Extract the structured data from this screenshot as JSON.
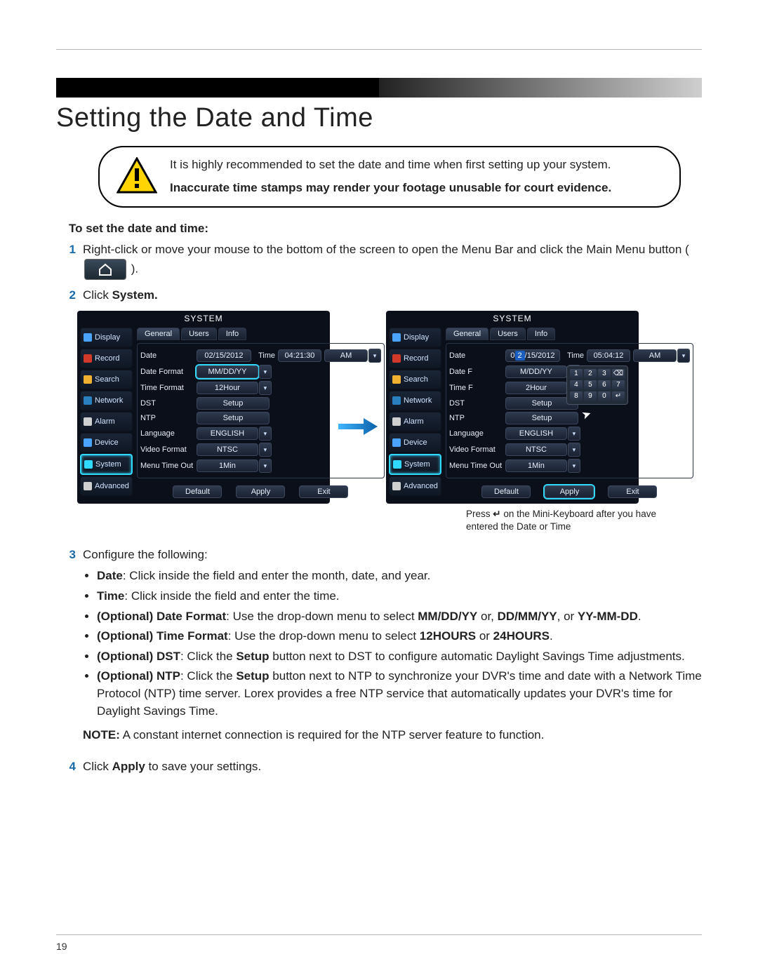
{
  "page_number": "19",
  "title": "Setting the Date and Time",
  "callout": {
    "line1": "It is highly recommended to set the date and time when first setting up your system.",
    "line2_bold": "Inaccurate time stamps may render your footage unusable for court evidence."
  },
  "subhead": "To set the date and time:",
  "steps": {
    "s1_a": "Right-click or move your mouse to the bottom of the screen to open the Menu Bar and click the Main Menu button (",
    "s1_b": ").",
    "s2_a": "Click ",
    "s2_b": "System.",
    "s3_intro": "Configure the following:",
    "s3_bullets": {
      "b1_bold": "Date",
      "b1_rest": ": Click inside the field and enter the month, date, and year.",
      "b2_bold": "Time",
      "b2_rest": ": Click inside the field and enter the time.",
      "b3_bold": "(Optional) Date Format",
      "b3_rest_a": ": Use the drop-down menu to select ",
      "b3_opt1": "MM/DD/YY",
      "b3_mid1": " or, ",
      "b3_opt2": "DD/MM/YY",
      "b3_mid2": ", or ",
      "b3_opt3": "YY-MM-DD",
      "b3_end": ".",
      "b4_bold": "(Optional) Time Format",
      "b4_rest_a": ": Use the drop-down menu to select ",
      "b4_opt1": "12HOURS",
      "b4_mid": " or ",
      "b4_opt2": "24HOURS",
      "b4_end": ".",
      "b5_bold": "(Optional) DST",
      "b5_rest_a": ": Click the ",
      "b5_setup": "Setup",
      "b5_rest_b": " button next to DST to configure automatic Daylight Savings Time adjustments.",
      "b6_bold": "(Optional) NTP",
      "b6_rest_a": ": Click the ",
      "b6_setup": "Setup",
      "b6_rest_b": " button next to NTP to synchronize your DVR's time and date with a Network Time Protocol (NTP) time server. Lorex provides a free NTP service that automatically updates your DVR's time for Daylight Savings Time."
    },
    "note_bold": "NOTE:",
    "note_rest": " A constant internet connection is required for the NTP server feature to function.",
    "s4_a": "Click ",
    "s4_b": "Apply",
    "s4_c": " to save your settings."
  },
  "caption": {
    "line1_a": "Press ",
    "line1_b": " on the Mini-Keyboard after you have entered the Date or Time"
  },
  "dvr": {
    "title": "SYSTEM",
    "side_items": [
      "Display",
      "Record",
      "Search",
      "Network",
      "Alarm",
      "Device",
      "System",
      "Advanced"
    ],
    "tabs": [
      "General",
      "Users",
      "Info"
    ],
    "left": {
      "date_label": "Date",
      "date_value": "02/15/2012",
      "time_label": "Time",
      "time_value": "04:21:30",
      "ampm": "AM",
      "rows": [
        {
          "label": "Date Format",
          "value": "MM/DD/YY",
          "type": "highlight-select"
        },
        {
          "label": "Time Format",
          "value": "12Hour",
          "type": "select"
        },
        {
          "label": "DST",
          "value": "Setup",
          "type": "button"
        },
        {
          "label": "NTP",
          "value": "Setup",
          "type": "button"
        },
        {
          "label": "Language",
          "value": "ENGLISH",
          "type": "select"
        },
        {
          "label": "Video Format",
          "value": "NTSC",
          "type": "select"
        },
        {
          "label": "Menu Time Out",
          "value": "1Min",
          "type": "select"
        }
      ],
      "buttons": [
        "Default",
        "Apply",
        "Exit"
      ]
    },
    "right": {
      "date_label": "Date",
      "date_prefix": "0",
      "date_hl": "2",
      "date_suffix": "/15/2012",
      "time_label": "Time",
      "time_value": "05:04:12",
      "ampm": "AM",
      "rows": [
        {
          "label": "Date F",
          "value": "M/DD/YY",
          "type": "select"
        },
        {
          "label": "Time F",
          "value": "2Hour",
          "type": "select"
        },
        {
          "label": "DST",
          "value": "Setup",
          "type": "button"
        },
        {
          "label": "NTP",
          "value": "Setup",
          "type": "button"
        },
        {
          "label": "Language",
          "value": "ENGLISH",
          "type": "select"
        },
        {
          "label": "Video Format",
          "value": "NTSC",
          "type": "select"
        },
        {
          "label": "Menu Time Out",
          "value": "1Min",
          "type": "select"
        }
      ],
      "buttons": [
        "Default",
        "Apply",
        "Exit"
      ],
      "keypad": [
        "1",
        "2",
        "3",
        "⌫",
        "4",
        "5",
        "6",
        "7",
        "8",
        "9",
        "0",
        "↵"
      ]
    }
  }
}
